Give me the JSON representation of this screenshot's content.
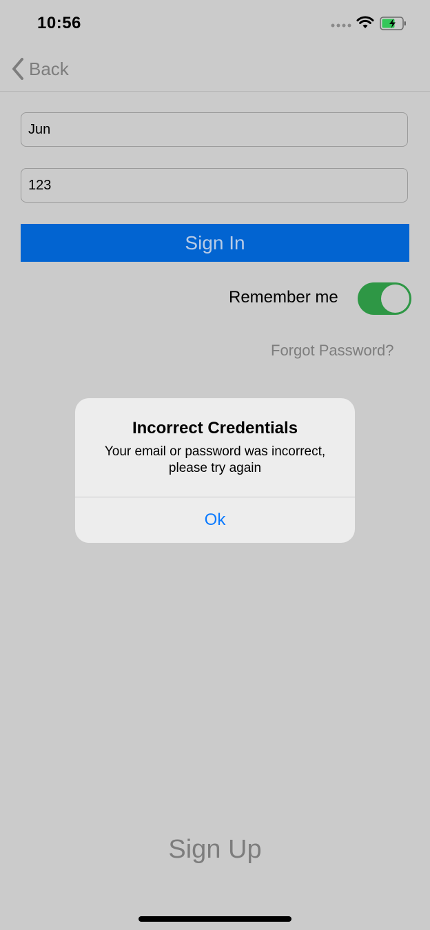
{
  "status_bar": {
    "time": "10:56"
  },
  "nav": {
    "back_label": "Back"
  },
  "form": {
    "username_value": "Jun",
    "password_value": "123",
    "sign_in_label": "Sign In",
    "remember_label": "Remember me",
    "remember_on": true,
    "forgot_label": "Forgot Password?",
    "sign_up_label": "Sign Up"
  },
  "alert": {
    "title": "Incorrect Credentials",
    "message_line1": "Your email or password was incorrect,",
    "message_line2": "please try again",
    "ok_label": "Ok"
  },
  "colors": {
    "background": "#cbcbcb",
    "primary_button": "#0264d1",
    "toggle_on": "#2e9745",
    "alert_action": "#0a7aff",
    "muted_text": "#7d7d7d"
  },
  "icons": {
    "back": "chevron-left-icon",
    "wifi": "wifi-icon",
    "battery": "battery-charging-icon",
    "signal": "signal-dots-icon"
  }
}
